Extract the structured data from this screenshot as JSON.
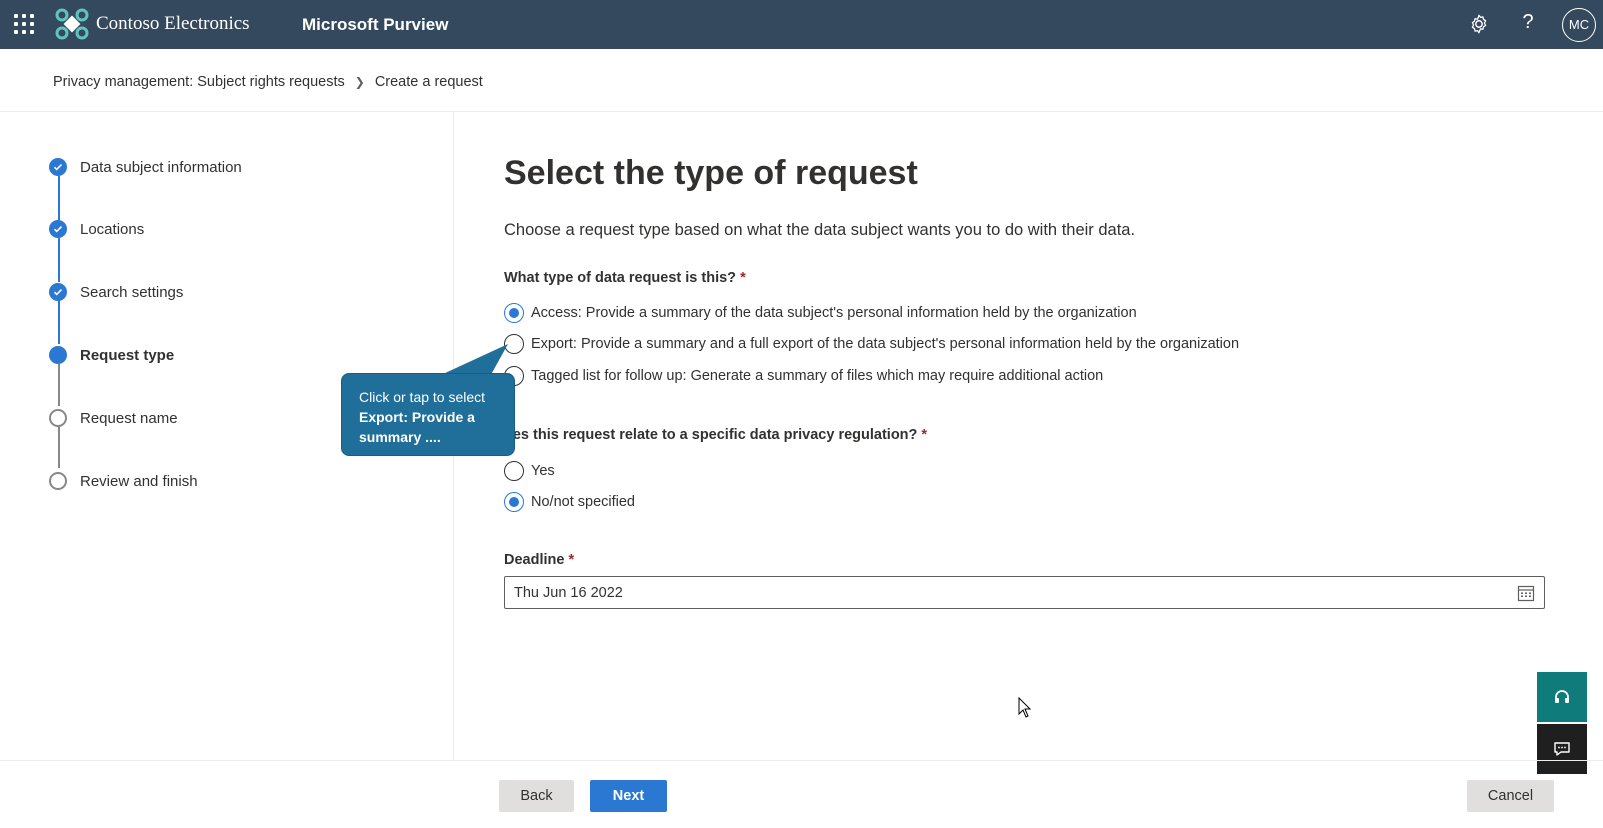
{
  "topbar": {
    "org_name": "Contoso Electronics",
    "app_name": "Microsoft Purview",
    "avatar_initials": "MC",
    "help_glyph": "?",
    "icons": [
      "app-launcher-icon",
      "contoso-logo-icon",
      "settings-gear-icon",
      "help-icon"
    ]
  },
  "breadcrumb": {
    "parent": "Privacy management: Subject rights requests",
    "current": "Create a request"
  },
  "steps": [
    {
      "label": "Data subject information",
      "state": "done"
    },
    {
      "label": "Locations",
      "state": "done"
    },
    {
      "label": "Search settings",
      "state": "done"
    },
    {
      "label": "Request type",
      "state": "current"
    },
    {
      "label": "Request name",
      "state": "todo"
    },
    {
      "label": "Review and finish",
      "state": "todo"
    }
  ],
  "main": {
    "title": "Select the type of request",
    "subtitle": "Choose a request type based on what the data subject wants you to do with their data.",
    "request_type": {
      "label": "What type of data request is this?",
      "required_mark": "*",
      "options": [
        {
          "label": "Access: Provide a summary of the data subject's personal information held by the organization",
          "checked": true
        },
        {
          "label": "Export: Provide a summary and a full export of the data subject's personal information held by the organization",
          "checked": false
        },
        {
          "label": "Tagged list for follow up: Generate a summary of files which may require additional action",
          "checked": false
        }
      ]
    },
    "regulation": {
      "label": "oes this request relate to a specific data privacy regulation?",
      "required_mark": "*",
      "options": [
        {
          "label": "Yes",
          "checked": false
        },
        {
          "label": "No/not specified",
          "checked": true
        }
      ]
    },
    "deadline": {
      "label": "Deadline",
      "required_mark": "*",
      "value": "Thu Jun 16 2022"
    }
  },
  "callout": {
    "line1": "Click or tap to select",
    "bold_text": "Export: Provide a summary ...."
  },
  "footer": {
    "back_label": "Back",
    "next_label": "Next",
    "cancel_label": "Cancel"
  },
  "colors": {
    "topbar_bg": "#34495e",
    "accent": "#2b78d3",
    "callout_bg": "#1f6f9a",
    "help_float_bg": "#0f7b7b"
  }
}
